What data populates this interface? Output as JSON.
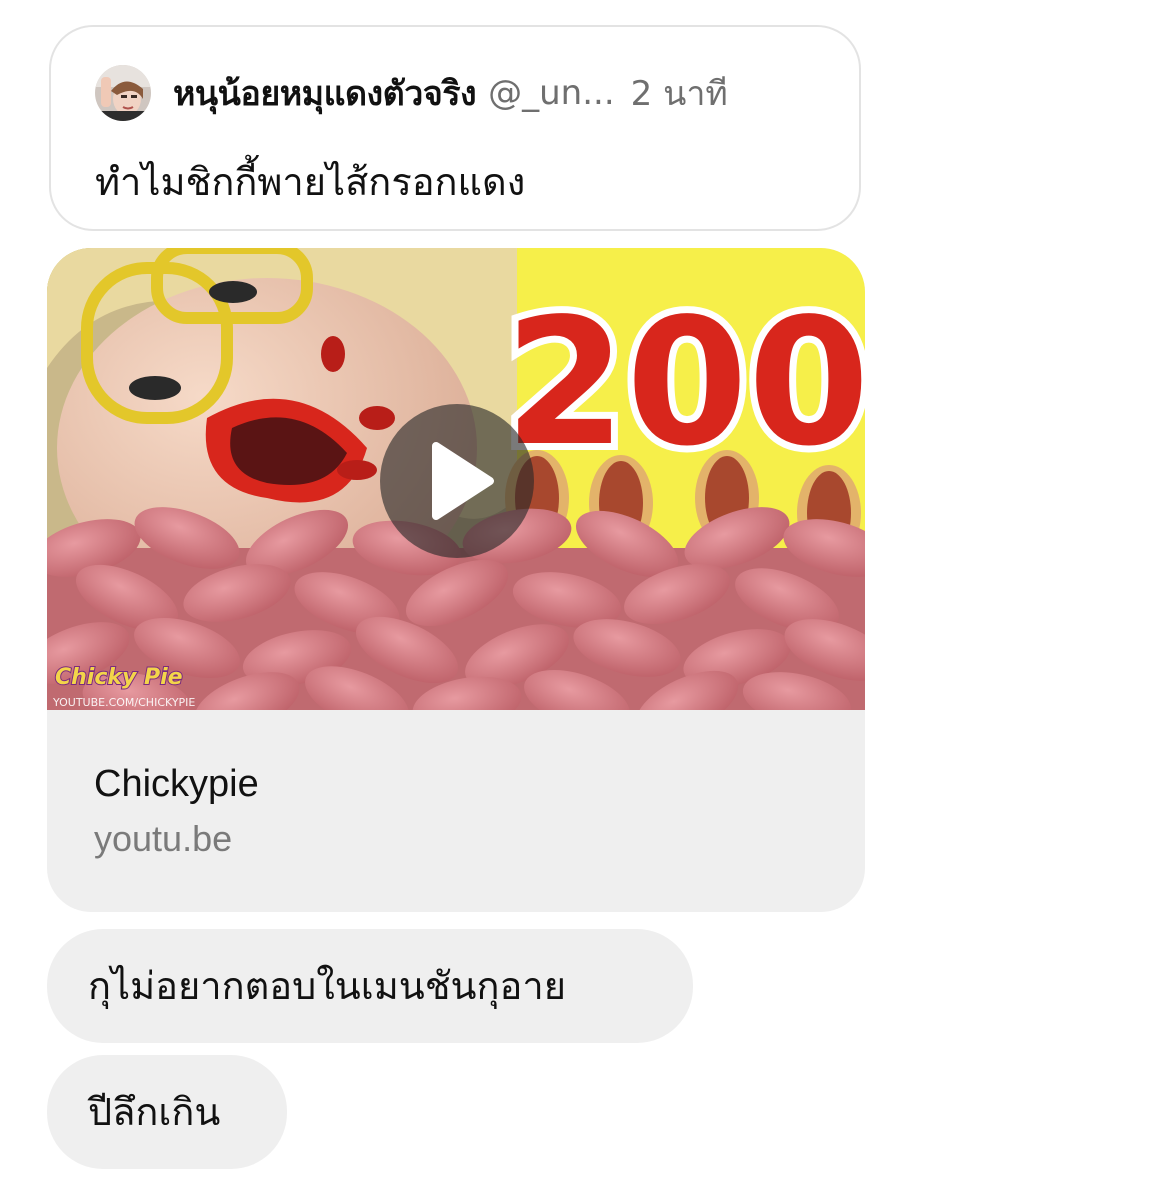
{
  "quoted_post": {
    "author_name": "หนุน้อยหมุแดงตัวจริง",
    "author_handle": "@_un...",
    "time": "2 นาที",
    "text": "ทำไมชิกกี้พายไส้กรอกแดง"
  },
  "link_preview": {
    "title": "Chickypie",
    "domain": "youtu.be",
    "thumbnail": {
      "big_number": "200",
      "logo_text": "Chicky Pie",
      "watermark": "YOUTUBE.COM/CHICKYPIE"
    }
  },
  "messages": [
    {
      "text": "กุไม่อยากตอบในเมนชันกุอาย"
    },
    {
      "text": "ปีลึกเกิน"
    }
  ],
  "colors": {
    "bubble_bg": "#efefef",
    "card_border": "#e3e3e3",
    "muted_text": "#6f6f6f",
    "thumb_yellow": "#f6ef4a",
    "thumb_red": "#d8261c",
    "sausage_pink": "#d9747a"
  }
}
